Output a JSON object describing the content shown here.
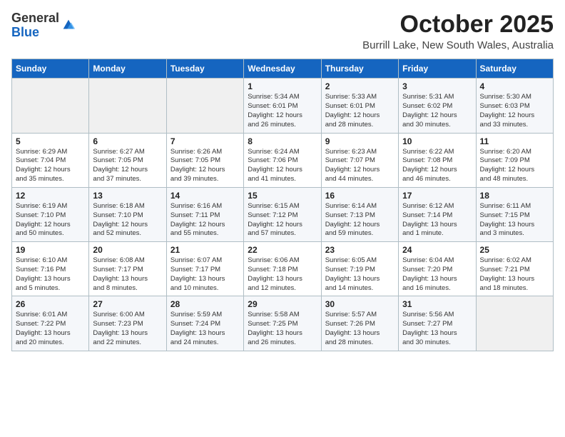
{
  "header": {
    "logo_general": "General",
    "logo_blue": "Blue",
    "month": "October 2025",
    "location": "Burrill Lake, New South Wales, Australia"
  },
  "days_of_week": [
    "Sunday",
    "Monday",
    "Tuesday",
    "Wednesday",
    "Thursday",
    "Friday",
    "Saturday"
  ],
  "weeks": [
    [
      {
        "day": "",
        "info": ""
      },
      {
        "day": "",
        "info": ""
      },
      {
        "day": "",
        "info": ""
      },
      {
        "day": "1",
        "info": "Sunrise: 5:34 AM\nSunset: 6:01 PM\nDaylight: 12 hours\nand 26 minutes."
      },
      {
        "day": "2",
        "info": "Sunrise: 5:33 AM\nSunset: 6:01 PM\nDaylight: 12 hours\nand 28 minutes."
      },
      {
        "day": "3",
        "info": "Sunrise: 5:31 AM\nSunset: 6:02 PM\nDaylight: 12 hours\nand 30 minutes."
      },
      {
        "day": "4",
        "info": "Sunrise: 5:30 AM\nSunset: 6:03 PM\nDaylight: 12 hours\nand 33 minutes."
      }
    ],
    [
      {
        "day": "5",
        "info": "Sunrise: 6:29 AM\nSunset: 7:04 PM\nDaylight: 12 hours\nand 35 minutes."
      },
      {
        "day": "6",
        "info": "Sunrise: 6:27 AM\nSunset: 7:05 PM\nDaylight: 12 hours\nand 37 minutes."
      },
      {
        "day": "7",
        "info": "Sunrise: 6:26 AM\nSunset: 7:05 PM\nDaylight: 12 hours\nand 39 minutes."
      },
      {
        "day": "8",
        "info": "Sunrise: 6:24 AM\nSunset: 7:06 PM\nDaylight: 12 hours\nand 41 minutes."
      },
      {
        "day": "9",
        "info": "Sunrise: 6:23 AM\nSunset: 7:07 PM\nDaylight: 12 hours\nand 44 minutes."
      },
      {
        "day": "10",
        "info": "Sunrise: 6:22 AM\nSunset: 7:08 PM\nDaylight: 12 hours\nand 46 minutes."
      },
      {
        "day": "11",
        "info": "Sunrise: 6:20 AM\nSunset: 7:09 PM\nDaylight: 12 hours\nand 48 minutes."
      }
    ],
    [
      {
        "day": "12",
        "info": "Sunrise: 6:19 AM\nSunset: 7:10 PM\nDaylight: 12 hours\nand 50 minutes."
      },
      {
        "day": "13",
        "info": "Sunrise: 6:18 AM\nSunset: 7:10 PM\nDaylight: 12 hours\nand 52 minutes."
      },
      {
        "day": "14",
        "info": "Sunrise: 6:16 AM\nSunset: 7:11 PM\nDaylight: 12 hours\nand 55 minutes."
      },
      {
        "day": "15",
        "info": "Sunrise: 6:15 AM\nSunset: 7:12 PM\nDaylight: 12 hours\nand 57 minutes."
      },
      {
        "day": "16",
        "info": "Sunrise: 6:14 AM\nSunset: 7:13 PM\nDaylight: 12 hours\nand 59 minutes."
      },
      {
        "day": "17",
        "info": "Sunrise: 6:12 AM\nSunset: 7:14 PM\nDaylight: 13 hours\nand 1 minute."
      },
      {
        "day": "18",
        "info": "Sunrise: 6:11 AM\nSunset: 7:15 PM\nDaylight: 13 hours\nand 3 minutes."
      }
    ],
    [
      {
        "day": "19",
        "info": "Sunrise: 6:10 AM\nSunset: 7:16 PM\nDaylight: 13 hours\nand 5 minutes."
      },
      {
        "day": "20",
        "info": "Sunrise: 6:08 AM\nSunset: 7:17 PM\nDaylight: 13 hours\nand 8 minutes."
      },
      {
        "day": "21",
        "info": "Sunrise: 6:07 AM\nSunset: 7:17 PM\nDaylight: 13 hours\nand 10 minutes."
      },
      {
        "day": "22",
        "info": "Sunrise: 6:06 AM\nSunset: 7:18 PM\nDaylight: 13 hours\nand 12 minutes."
      },
      {
        "day": "23",
        "info": "Sunrise: 6:05 AM\nSunset: 7:19 PM\nDaylight: 13 hours\nand 14 minutes."
      },
      {
        "day": "24",
        "info": "Sunrise: 6:04 AM\nSunset: 7:20 PM\nDaylight: 13 hours\nand 16 minutes."
      },
      {
        "day": "25",
        "info": "Sunrise: 6:02 AM\nSunset: 7:21 PM\nDaylight: 13 hours\nand 18 minutes."
      }
    ],
    [
      {
        "day": "26",
        "info": "Sunrise: 6:01 AM\nSunset: 7:22 PM\nDaylight: 13 hours\nand 20 minutes."
      },
      {
        "day": "27",
        "info": "Sunrise: 6:00 AM\nSunset: 7:23 PM\nDaylight: 13 hours\nand 22 minutes."
      },
      {
        "day": "28",
        "info": "Sunrise: 5:59 AM\nSunset: 7:24 PM\nDaylight: 13 hours\nand 24 minutes."
      },
      {
        "day": "29",
        "info": "Sunrise: 5:58 AM\nSunset: 7:25 PM\nDaylight: 13 hours\nand 26 minutes."
      },
      {
        "day": "30",
        "info": "Sunrise: 5:57 AM\nSunset: 7:26 PM\nDaylight: 13 hours\nand 28 minutes."
      },
      {
        "day": "31",
        "info": "Sunrise: 5:56 AM\nSunset: 7:27 PM\nDaylight: 13 hours\nand 30 minutes."
      },
      {
        "day": "",
        "info": ""
      }
    ]
  ]
}
